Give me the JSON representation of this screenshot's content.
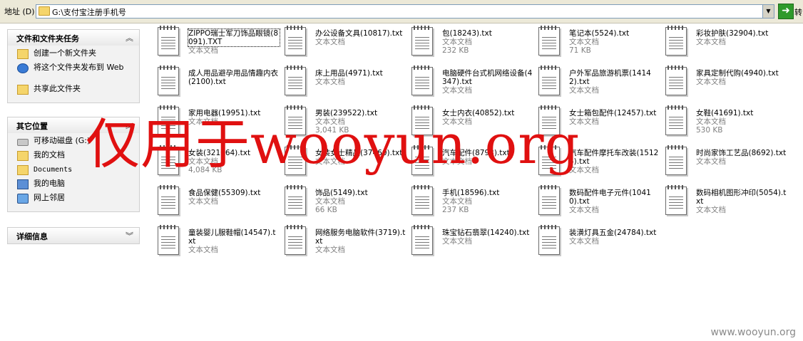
{
  "address_bar": {
    "label": "地址 (D)",
    "path": "G:\\支付宝注册手机号",
    "go_label": "转"
  },
  "task_pane": {
    "tasks": {
      "title": "文件和文件夹任务",
      "items": [
        {
          "label": "创建一个新文件夹",
          "icon": "new-folder-icon"
        },
        {
          "label": "将这个文件夹发布到 Web",
          "icon": "publish-web-icon"
        },
        {
          "label": "共享此文件夹",
          "icon": "share-folder-icon"
        }
      ]
    },
    "other_places": {
      "title": "其它位置",
      "items": [
        {
          "label": "可移动磁盘 (G:)",
          "icon": "removable-drive-icon"
        },
        {
          "label": "我的文档",
          "icon": "my-documents-icon"
        },
        {
          "label": "Documents",
          "icon": "documents-icon"
        },
        {
          "label": "我的电脑",
          "icon": "my-computer-icon"
        },
        {
          "label": "网上邻居",
          "icon": "network-places-icon"
        }
      ]
    },
    "details": {
      "title": "详细信息"
    }
  },
  "files": [
    {
      "name": "ZIPPO瑞士军刀饰品眼镜(8091).TXT",
      "type": "文本文档",
      "size": "",
      "selected": true
    },
    {
      "name": "办公设备文具(10817).txt",
      "type": "文本文档",
      "size": ""
    },
    {
      "name": "包(18243).txt",
      "type": "文本文档",
      "size": "232 KB"
    },
    {
      "name": "笔记本(5524).txt",
      "type": "文本文档",
      "size": "71 KB"
    },
    {
      "name": "彩妆护肤(32904).txt",
      "type": "文本文档",
      "size": ""
    },
    {
      "name": "成人用品避孕用品情趣内衣(2100).txt",
      "type": "",
      "size": ""
    },
    {
      "name": "床上用品(4971).txt",
      "type": "文本文档",
      "size": ""
    },
    {
      "name": "电脑硬件台式机网络设备(4347).txt",
      "type": "文本文档",
      "size": ""
    },
    {
      "name": "户外军品旅游机票(14142).txt",
      "type": "文本文档",
      "size": ""
    },
    {
      "name": "家具定制代购(4940).txt",
      "type": "文本文档",
      "size": ""
    },
    {
      "name": "家用电器(19951).txt",
      "type": "文本文档",
      "size": ""
    },
    {
      "name": "男装(239522).txt",
      "type": "文本文档",
      "size": "3,041 KB"
    },
    {
      "name": "女士内衣(40852).txt",
      "type": "文本文档",
      "size": ""
    },
    {
      "name": "女士箱包配件(12457).txt",
      "type": "文本文档",
      "size": ""
    },
    {
      "name": "女鞋(41691).txt",
      "type": "文本文档",
      "size": "530 KB"
    },
    {
      "name": "女装(321664).txt",
      "type": "文本文档",
      "size": "4,084 KB"
    },
    {
      "name": "女装女士精品(37460).txt",
      "type": "文本文档",
      "size": ""
    },
    {
      "name": "汽车配件(8793).txt",
      "type": "文本文档",
      "size": ""
    },
    {
      "name": "汽车配件摩托车改装(15124).txt",
      "type": "文本文档",
      "size": ""
    },
    {
      "name": "时尚家饰工艺品(8692).txt",
      "type": "文本文档",
      "size": ""
    },
    {
      "name": "食品保健(55309).txt",
      "type": "文本文档",
      "size": ""
    },
    {
      "name": "饰品(5149).txt",
      "type": "文本文档",
      "size": "66 KB"
    },
    {
      "name": "手机(18596).txt",
      "type": "文本文档",
      "size": "237 KB"
    },
    {
      "name": "数码配件电子元件(10410).txt",
      "type": "文本文档",
      "size": ""
    },
    {
      "name": "数码相机图形冲印(5054).txt",
      "type": "文本文档",
      "size": ""
    },
    {
      "name": "童装婴儿服鞋帽(14547).txt",
      "type": "文本文档",
      "size": ""
    },
    {
      "name": "网络服务电脑软件(3719).txt",
      "type": "文本文档",
      "size": ""
    },
    {
      "name": "珠宝钻石翡翠(14240).txt",
      "type": "文本文档",
      "size": ""
    },
    {
      "name": "装潢灯具五金(24784).txt",
      "type": "文本文档",
      "size": ""
    }
  ],
  "watermark": "仅用于wooyun.org",
  "corner_watermark": "www.wooyun.org"
}
